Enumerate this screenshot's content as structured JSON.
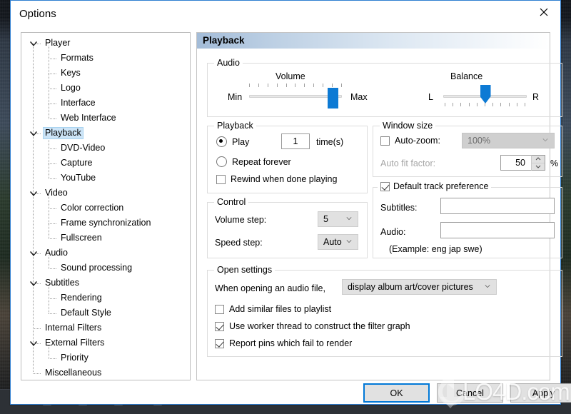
{
  "window": {
    "title": "Options",
    "close_icon": "close-icon"
  },
  "tree": {
    "nodes": [
      {
        "label": "Player",
        "level": 0,
        "expander": "chevron-down-icon",
        "selected": false
      },
      {
        "label": "Formats",
        "level": 1,
        "expander": "",
        "selected": false
      },
      {
        "label": "Keys",
        "level": 1,
        "expander": "",
        "selected": false
      },
      {
        "label": "Logo",
        "level": 1,
        "expander": "",
        "selected": false
      },
      {
        "label": "Interface",
        "level": 1,
        "expander": "",
        "selected": false
      },
      {
        "label": "Web Interface",
        "level": 1,
        "expander": "",
        "selected": false
      },
      {
        "label": "Playback",
        "level": 0,
        "expander": "chevron-down-icon",
        "selected": true
      },
      {
        "label": "DVD-Video",
        "level": 1,
        "expander": "",
        "selected": false
      },
      {
        "label": "Capture",
        "level": 1,
        "expander": "",
        "selected": false
      },
      {
        "label": "YouTube",
        "level": 1,
        "expander": "",
        "selected": false
      },
      {
        "label": "Video",
        "level": 0,
        "expander": "chevron-down-icon",
        "selected": false
      },
      {
        "label": "Color correction",
        "level": 1,
        "expander": "",
        "selected": false
      },
      {
        "label": "Frame synchronization",
        "level": 1,
        "expander": "",
        "selected": false
      },
      {
        "label": "Fullscreen",
        "level": 1,
        "expander": "",
        "selected": false
      },
      {
        "label": "Audio",
        "level": 0,
        "expander": "chevron-down-icon",
        "selected": false
      },
      {
        "label": "Sound processing",
        "level": 1,
        "expander": "",
        "selected": false
      },
      {
        "label": "Subtitles",
        "level": 0,
        "expander": "chevron-down-icon",
        "selected": false
      },
      {
        "label": "Rendering",
        "level": 1,
        "expander": "",
        "selected": false
      },
      {
        "label": "Default Style",
        "level": 1,
        "expander": "",
        "selected": false
      },
      {
        "label": "Internal Filters",
        "level": 0,
        "expander": "",
        "selected": false
      },
      {
        "label": "External Filters",
        "level": 0,
        "expander": "chevron-down-icon",
        "selected": false
      },
      {
        "label": "Priority",
        "level": 1,
        "expander": "",
        "selected": false
      },
      {
        "label": "Miscellaneous",
        "level": 0,
        "expander": "",
        "selected": false
      }
    ]
  },
  "pane": {
    "header": "Playback",
    "audio": {
      "caption": "Audio",
      "volume_label": "Volume",
      "volume_min": "Min",
      "volume_max": "Max",
      "volume_value_pct": 92,
      "volume_ticks": 11,
      "balance_label": "Balance",
      "balance_left": "L",
      "balance_right": "R",
      "balance_value_pct": 50,
      "balance_ticks": 11
    },
    "playback": {
      "caption": "Playback",
      "play_label": "Play",
      "play_selected": true,
      "times_value": "1",
      "times_label": "time(s)",
      "repeat_label": "Repeat forever",
      "repeat_selected": false,
      "rewind_label": "Rewind when done playing",
      "rewind_checked": false
    },
    "window_size": {
      "caption": "Window size",
      "autozoom_label": "Auto-zoom:",
      "autozoom_checked": false,
      "autozoom_value": "100%",
      "autofit_label": "Auto fit factor:",
      "autofit_value": "50",
      "autofit_unit": "%"
    },
    "control": {
      "caption": "Control",
      "volume_step_label": "Volume step:",
      "volume_step_value": "5",
      "speed_step_label": "Speed step:",
      "speed_step_value": "Auto"
    },
    "track_pref": {
      "caption": "Default track preference",
      "checked": true,
      "subtitles_label": "Subtitles:",
      "subtitles_value": "",
      "audio_label": "Audio:",
      "audio_value": "",
      "example": "(Example: eng jap swe)"
    },
    "open_settings": {
      "caption": "Open settings",
      "when_opening_label": "When opening an audio file,",
      "when_opening_value": "display album art/cover pictures",
      "add_similar_label": "Add similar files to playlist",
      "add_similar_checked": false,
      "worker_thread_label": "Use worker thread to construct the filter graph",
      "worker_thread_checked": true,
      "report_pins_label": "Report pins which fail to render",
      "report_pins_checked": true
    }
  },
  "buttons": {
    "ok": "OK",
    "cancel": "Cancel",
    "apply": "Apply"
  },
  "watermark": {
    "text_main": "LO4D",
    "text_suffix": ".com",
    "logo_icon": "circular-arrows-icon"
  }
}
